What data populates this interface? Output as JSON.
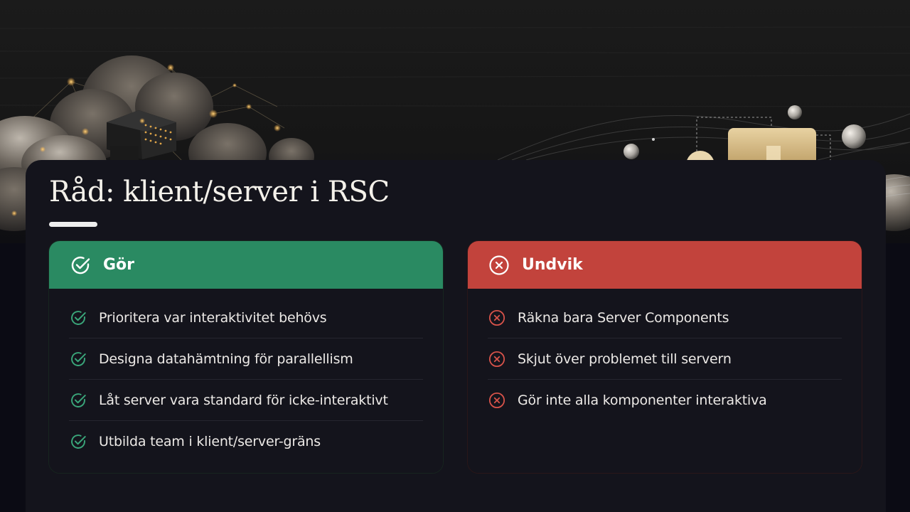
{
  "slide": {
    "title": "Råd: klient/server i RSC"
  },
  "do_panel": {
    "heading": "Gör",
    "icon": "check-circle-icon",
    "color": "#2a8a62",
    "items": [
      {
        "label": "Prioritera var interaktivitet behövs"
      },
      {
        "label": "Designa datahämtning för parallellism"
      },
      {
        "label": "Låt server vara standard för icke-interaktivt"
      },
      {
        "label": "Utbilda team i klient/server-gräns"
      }
    ]
  },
  "avoid_panel": {
    "heading": "Undvik",
    "icon": "x-circle-icon",
    "color": "#c2433c",
    "items": [
      {
        "label": "Räkna bara Server Components"
      },
      {
        "label": "Skjut över problemet till servern"
      },
      {
        "label": "Gör inte alla komponenter interaktiva"
      }
    ]
  },
  "colors": {
    "background": "#0b0b14",
    "card": "#14141c",
    "accent_green": "#2a8a62",
    "accent_red": "#c2433c",
    "icon_green": "#3aa67a",
    "icon_red": "#d8534a"
  }
}
